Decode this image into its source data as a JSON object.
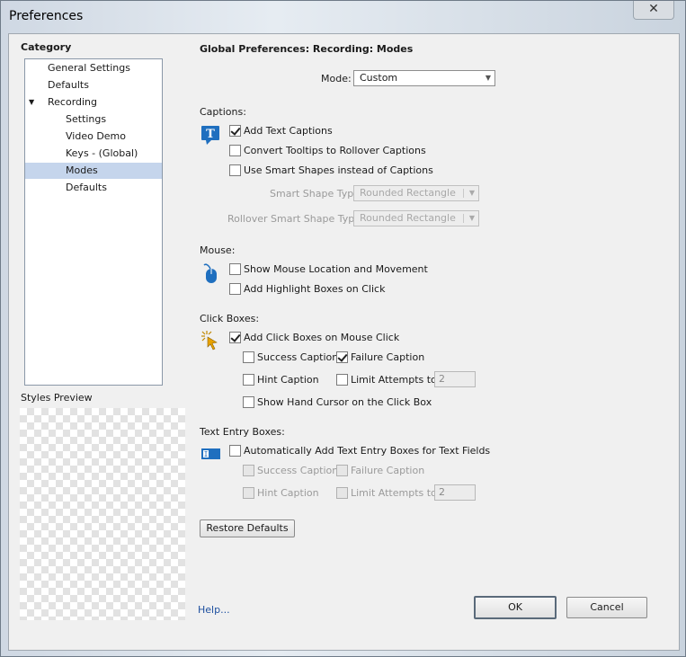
{
  "window": {
    "title": "Preferences",
    "close_glyph": "✕"
  },
  "sidebar": {
    "heading": "Category",
    "items": [
      {
        "label": "General Settings"
      },
      {
        "label": "Defaults"
      },
      {
        "label": "Recording",
        "toggle": "▼"
      },
      {
        "label": "Settings"
      },
      {
        "label": "Video Demo"
      },
      {
        "label": "Keys - (Global)"
      },
      {
        "label": "Modes"
      },
      {
        "label": "Defaults"
      }
    ],
    "selected": "Modes",
    "styles_preview_label": "Styles Preview",
    "help_link": "Help..."
  },
  "main": {
    "title": "Global Preferences: Recording: Modes",
    "mode": {
      "label": "Mode:",
      "value": "Custom",
      "arrow": "▼"
    },
    "captions": {
      "heading": "Captions:",
      "icon": "text-caption-icon",
      "icon_glyph": "T",
      "add_text_captions": {
        "label": "Add Text Captions",
        "checked": true
      },
      "convert_tooltips": {
        "label": "Convert Tooltips to Rollover Captions",
        "checked": false
      },
      "use_smart_shapes": {
        "label": "Use Smart Shapes instead of Captions",
        "checked": false
      },
      "smart_shape_type": {
        "label": "Smart Shape Type",
        "value": "Rounded Rectangle",
        "enabled": false
      },
      "rollover_smart_shape_type": {
        "label": "Rollover Smart Shape Type",
        "value": "Rounded Rectangle",
        "enabled": false
      }
    },
    "mouse": {
      "heading": "Mouse:",
      "icon": "mouse-icon",
      "show_mouse_location": {
        "label": "Show Mouse Location and Movement",
        "checked": false
      },
      "add_highlight_boxes": {
        "label": "Add Highlight Boxes on Click",
        "checked": false
      }
    },
    "click_boxes": {
      "heading": "Click Boxes:",
      "icon": "click-box-icon",
      "add_click_boxes": {
        "label": "Add Click Boxes on Mouse Click",
        "checked": true
      },
      "success_caption": {
        "label": "Success Caption",
        "checked": false
      },
      "failure_caption": {
        "label": "Failure Caption",
        "checked": true
      },
      "hint_caption": {
        "label": "Hint Caption",
        "checked": false
      },
      "limit_attempts": {
        "label": "Limit Attempts to",
        "checked": false,
        "value": "2"
      },
      "show_hand_cursor": {
        "label": "Show Hand Cursor on the Click Box",
        "checked": false
      }
    },
    "text_entry_boxes": {
      "heading": "Text Entry Boxes:",
      "icon": "text-entry-box-icon",
      "icon_glyph": "I",
      "auto_add": {
        "label": "Automatically Add Text Entry Boxes for Text Fields",
        "checked": false
      },
      "success_caption": {
        "label": "Success Caption",
        "checked": false,
        "enabled": false
      },
      "failure_caption": {
        "label": "Failure Caption",
        "checked": false,
        "enabled": false
      },
      "hint_caption": {
        "label": "Hint Caption",
        "checked": false,
        "enabled": false
      },
      "limit_attempts": {
        "label": "Limit Attempts to",
        "checked": false,
        "enabled": false,
        "value": "2"
      }
    },
    "restore_defaults": "Restore Defaults"
  },
  "footer": {
    "ok": "OK",
    "cancel": "Cancel"
  },
  "colors": {
    "selection": "#c5d5ec",
    "caption_icon": "#1f6fbf",
    "link": "#1d4f9f",
    "click_icon": "#e8a200"
  }
}
